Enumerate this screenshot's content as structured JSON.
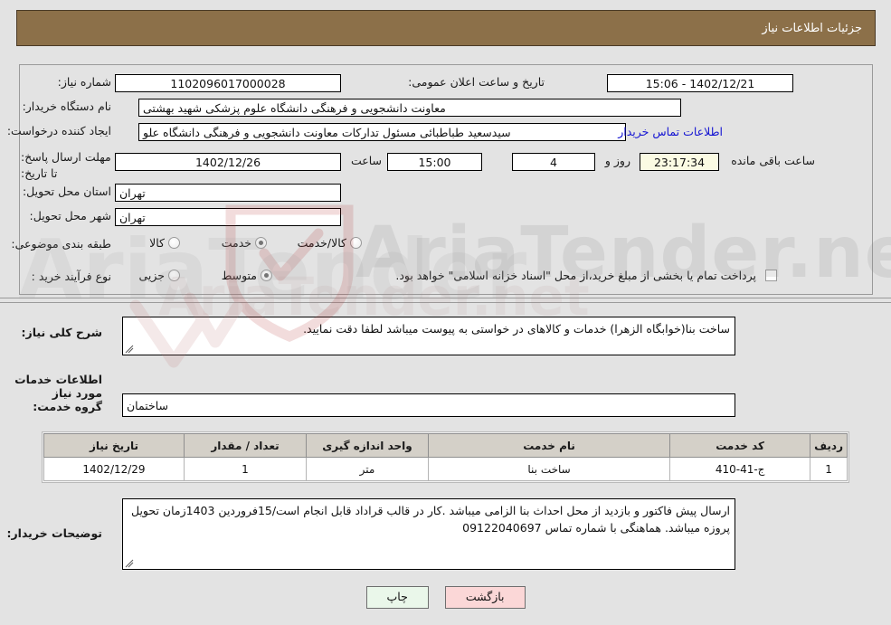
{
  "header": {
    "title": "جزئیات اطلاعات نیاز"
  },
  "form": {
    "need_number_label": "شماره نیاز:",
    "need_number_value": "1102096017000028",
    "public_announce_label": "تاریخ و ساعت اعلان عمومی:",
    "public_announce_value": "1402/12/21 - 15:06",
    "buyer_org_label": "نام دستگاه خریدار:",
    "buyer_org_value": "معاونت دانشجویی و فرهنگی دانشگاه علوم پزشکی شهید بهشتی",
    "requester_label": "ایجاد کننده درخواست:",
    "requester_value": "سیدسعید طباطبائی مسئول تدارکات معاونت دانشجویی و فرهنگی دانشگاه علو",
    "buyer_contact_link": "اطلاعات تماس خریدار",
    "deadline_label": "مهلت ارسال پاسخ: تا تاریخ:",
    "deadline_date": "1402/12/26",
    "deadline_hour_label": "ساعت",
    "deadline_hour_value": "15:00",
    "remaining_days_value": "4",
    "remaining_days_label": "روز و",
    "remaining_time_value": "23:17:34",
    "remaining_time_label": "ساعت باقی مانده",
    "province_label": "استان محل تحویل:",
    "province_value": "تهران",
    "city_label": "شهر محل تحویل:",
    "city_value": "تهران",
    "category_label": "طبقه بندی موضوعی:",
    "category_options": [
      {
        "label": "کالا",
        "checked": false
      },
      {
        "label": "خدمت",
        "checked": true
      },
      {
        "label": "کالا/خدمت",
        "checked": false
      }
    ],
    "process_label": "نوع فرآیند خرید :",
    "process_options": [
      {
        "label": "جزیی",
        "checked": false
      },
      {
        "label": "متوسط",
        "checked": true
      }
    ],
    "treasury_checkbox_label": "پرداخت تمام یا بخشی از مبلغ خرید،از محل \"اسناد خزانه اسلامی\" خواهد بود.",
    "treasury_checked": false
  },
  "description": {
    "label": "شرح کلی نیاز:",
    "value": "ساخت بنا(خوابگاه الزهرا) خدمات و کالاهای در خواستی به پیوست میباشد لطفا دقت نمایید."
  },
  "services_section": {
    "title": "اطلاعات خدمات مورد نیاز",
    "group_label": "گروه خدمت:",
    "group_value": "ساختمان"
  },
  "table": {
    "headers": [
      "ردیف",
      "کد خدمت",
      "نام خدمت",
      "واحد اندازه گیری",
      "تعداد / مقدار",
      "تاریخ نیاز"
    ],
    "rows": [
      [
        "1",
        "ج-41-410",
        "ساخت بنا",
        "متر",
        "1",
        "1402/12/29"
      ]
    ]
  },
  "buyer_notes": {
    "label": "توضیحات خریدار:",
    "value": "ارسال پیش فاکتور و بازدید از محل احداث بنا الزامی میباشد .کار در قالب قراداد قابل انجام است/15فروردین 1403زمان تحویل پروزه میباشد. هماهنگی با شماره تماس 09122040697"
  },
  "buttons": {
    "print": "چاپ",
    "back": "بازگشت"
  },
  "watermark": {
    "text": "AriaTender.net"
  },
  "colors": {
    "header_bar": "#8c7049",
    "link": "#1414d2",
    "print_button": "#eaf7ea",
    "back_button": "#fbd7d7",
    "countdown_field": "#fbfbe3",
    "table_header": "#d4d0c8",
    "page_background": "#e3e3e3"
  }
}
